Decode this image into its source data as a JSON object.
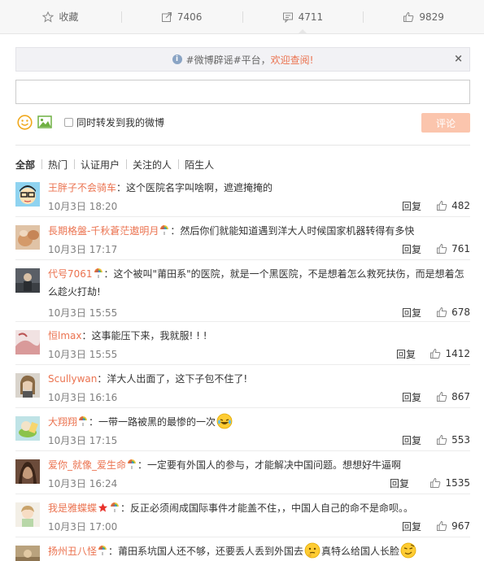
{
  "action_bar": {
    "favorite_label": "收藏",
    "repost_count": "7406",
    "comment_count": "4711",
    "like_count": "9829"
  },
  "notice": {
    "text_prefix": "#微博辟谣#平台，",
    "link_text": "欢迎查阅!",
    "close_symbol": "×"
  },
  "composer": {
    "input_value": "",
    "checkbox_label": "同时转发到我的微博",
    "submit_label": "评论"
  },
  "filters": [
    "全部",
    "热门",
    "认证用户",
    "关注的人",
    "陌生人"
  ],
  "reply_label": "回复",
  "comments": [
    {
      "user": "王胖子不会骑车",
      "content": "：这个医院名字叫啥啊，遮遮掩掩的",
      "time": "10月3日 18:20",
      "likes": "482"
    },
    {
      "user": "長期格盤-千秋蒼茫遨明月",
      "content": "：然后你们就能知道遇到洋大人时候国家机器转得有多快",
      "time": "10月3日 17:17",
      "likes": "761"
    },
    {
      "user": "代号7061",
      "content": "：这个被叫\"莆田系\"的医院，就是一个黑医院，不是想着怎么救死扶伤，而是想着怎么趁火打劫!",
      "time": "10月3日 15:55",
      "likes": "678"
    },
    {
      "user": "恒lmax",
      "content": "：这事能压下来，我就服! ! !",
      "time": "10月3日 15:55",
      "likes": "1412"
    },
    {
      "user": "Scullywan",
      "content": "：洋大人出面了，这下子包不住了!",
      "time": "10月3日 16:16",
      "likes": "867"
    },
    {
      "user": "大翔翔",
      "content": "：一带一路被黑的最惨的一次",
      "time": "10月3日 17:15",
      "likes": "553"
    },
    {
      "user": "爱你_就像_爱生命",
      "content": "：一定要有外国人的参与，才能解决中国问题。想想好牛逼啊",
      "time": "10月3日 16:24",
      "likes": "1535"
    },
    {
      "user": "我是雅蝶蝶",
      "content": "：反正必须闹成国际事件才能盖不住，，中国人自己的命不是命呗。。",
      "time": "10月3日 17:00",
      "likes": "967"
    },
    {
      "user": "扬州丑八怪",
      "content": "：莆田系坑国人还不够，还要丢人丢到外国去",
      "content_tail": "真特么给国人长脸",
      "time": "",
      "likes": ""
    }
  ],
  "colors": {
    "accent": "#eb7350",
    "submit_disabled": "#fbc5ad",
    "meta_text": "#808080"
  },
  "icons": [
    "star-icon",
    "repost-icon",
    "comment-icon",
    "thumb-up-icon",
    "info-icon",
    "smiley-icon",
    "picture-icon",
    "rainbow-badge-icon",
    "red-star-badge-icon"
  ]
}
